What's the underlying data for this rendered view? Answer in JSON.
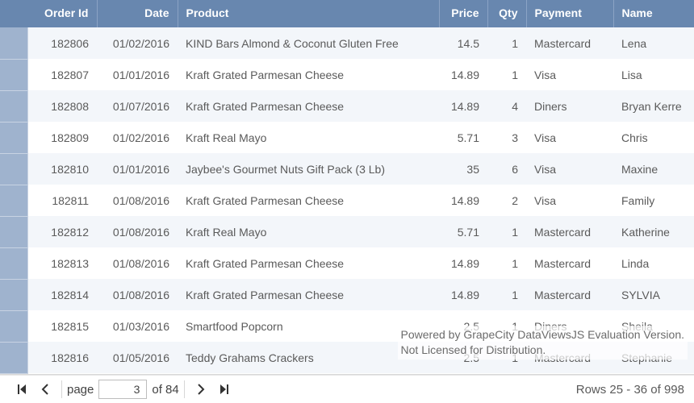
{
  "columns": {
    "order_id": "Order Id",
    "date": "Date",
    "product": "Product",
    "price": "Price",
    "qty": "Qty",
    "payment": "Payment",
    "name": "Name"
  },
  "rows": [
    {
      "order_id": "182806",
      "date": "01/02/2016",
      "product": "KIND Bars Almond & Coconut Gluten Free",
      "price": "14.5",
      "qty": "1",
      "payment": "Mastercard",
      "name": "Lena"
    },
    {
      "order_id": "182807",
      "date": "01/01/2016",
      "product": "Kraft Grated Parmesan Cheese",
      "price": "14.89",
      "qty": "1",
      "payment": "Visa",
      "name": "Lisa"
    },
    {
      "order_id": "182808",
      "date": "01/07/2016",
      "product": "Kraft Grated Parmesan Cheese",
      "price": "14.89",
      "qty": "4",
      "payment": "Diners",
      "name": "Bryan Kerre"
    },
    {
      "order_id": "182809",
      "date": "01/02/2016",
      "product": "Kraft Real Mayo",
      "price": "5.71",
      "qty": "3",
      "payment": "Visa",
      "name": "Chris"
    },
    {
      "order_id": "182810",
      "date": "01/01/2016",
      "product": "Jaybee's Gourmet Nuts Gift Pack (3 Lb)",
      "price": "35",
      "qty": "6",
      "payment": "Visa",
      "name": "Maxine"
    },
    {
      "order_id": "182811",
      "date": "01/08/2016",
      "product": "Kraft Grated Parmesan Cheese",
      "price": "14.89",
      "qty": "2",
      "payment": "Visa",
      "name": "Family"
    },
    {
      "order_id": "182812",
      "date": "01/08/2016",
      "product": "Kraft Real Mayo",
      "price": "5.71",
      "qty": "1",
      "payment": "Mastercard",
      "name": "Katherine"
    },
    {
      "order_id": "182813",
      "date": "01/08/2016",
      "product": "Kraft Grated Parmesan Cheese",
      "price": "14.89",
      "qty": "1",
      "payment": "Mastercard",
      "name": "Linda"
    },
    {
      "order_id": "182814",
      "date": "01/08/2016",
      "product": "Kraft Grated Parmesan Cheese",
      "price": "14.89",
      "qty": "1",
      "payment": "Mastercard",
      "name": "SYLVIA"
    },
    {
      "order_id": "182815",
      "date": "01/03/2016",
      "product": "Smartfood Popcorn",
      "price": "2.5",
      "qty": "1",
      "payment": "Diners",
      "name": "Sheila"
    },
    {
      "order_id": "182816",
      "date": "01/05/2016",
      "product": "Teddy Grahams Crackers",
      "price": "2.5",
      "qty": "1",
      "payment": "Mastercard",
      "name": "Stephanie"
    }
  ],
  "pager": {
    "page_label": "page",
    "page_value": "3",
    "of_label": "of 84",
    "rows_info": "Rows 25 - 36 of 998"
  },
  "watermark": {
    "line1": "Powered by GrapeCity DataViewsJS Evaluation Version.",
    "line2": "Not Licensed for Distribution."
  }
}
